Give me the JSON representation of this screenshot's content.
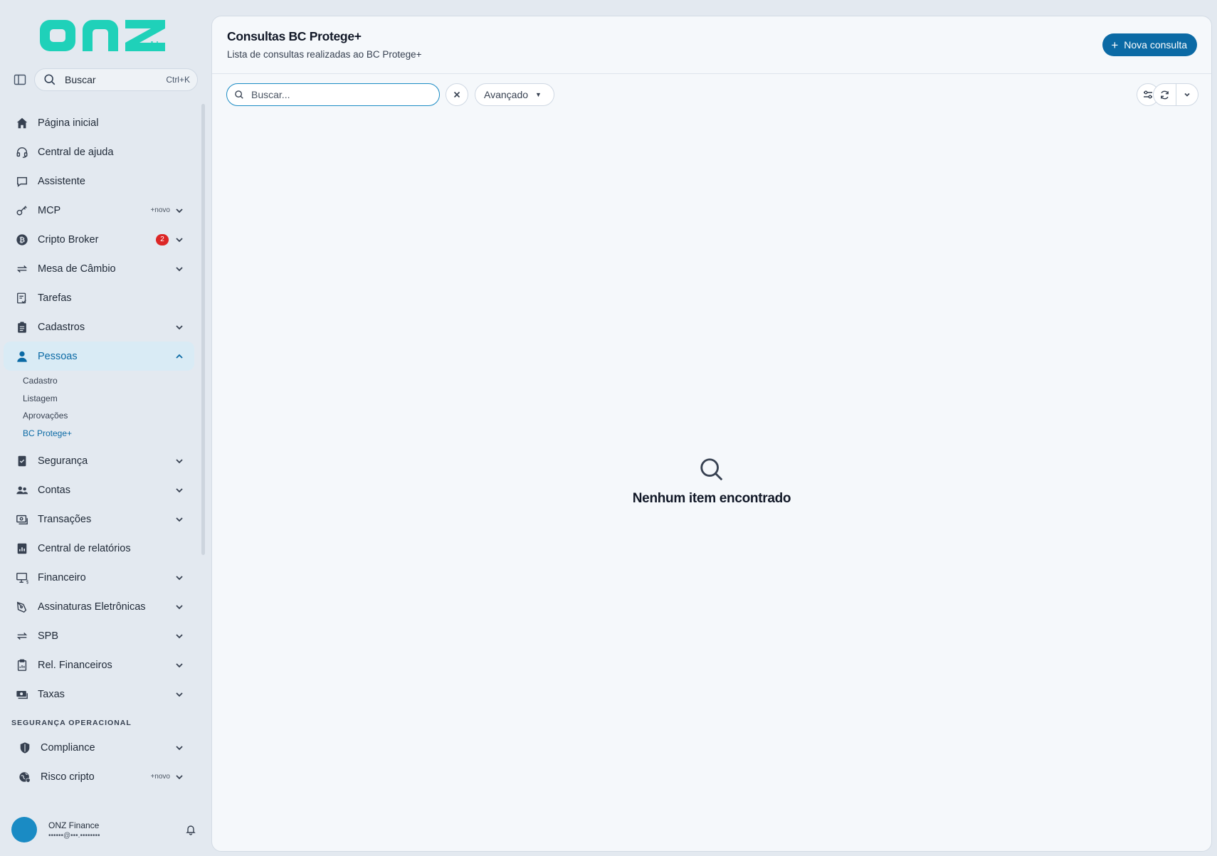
{
  "app": {
    "logo_text": "onz",
    "brand_color": "#1fd1b9",
    "accent_color": "#0b6aa5"
  },
  "sidebar": {
    "search_label": "Buscar",
    "search_shortcut": "Ctrl+K",
    "items": [
      {
        "label": "Página inicial",
        "icon": "home-icon"
      },
      {
        "label": "Central de ajuda",
        "icon": "headset-icon"
      },
      {
        "label": "Assistente",
        "icon": "chat-icon"
      },
      {
        "label": "MCP",
        "icon": "key-icon",
        "tag": "+novo"
      },
      {
        "label": "Cripto Broker",
        "icon": "bitcoin-icon",
        "badge": "2"
      },
      {
        "label": "Mesa de Câmbio",
        "icon": "exchange-icon"
      },
      {
        "label": "Tarefas",
        "icon": "tasks-icon"
      },
      {
        "label": "Cadastros",
        "icon": "clipboard-icon"
      },
      {
        "label": "Pessoas",
        "icon": "person-icon"
      },
      {
        "label": "Segurança",
        "icon": "shield-phone-icon"
      },
      {
        "label": "Contas",
        "icon": "users-icon"
      },
      {
        "label": "Transações",
        "icon": "transactions-icon"
      },
      {
        "label": "Central de relatórios",
        "icon": "report-icon"
      },
      {
        "label": "Financeiro",
        "icon": "monitor-money-icon"
      },
      {
        "label": "Assinaturas Eletrônicas",
        "icon": "pen-icon"
      },
      {
        "label": "SPB",
        "icon": "transfer-icon"
      },
      {
        "label": "Rel. Financeiros",
        "icon": "doc-money-icon"
      },
      {
        "label": "Taxas",
        "icon": "cash-icon"
      }
    ],
    "pessoas_subitems": [
      "Cadastro",
      "Listagem",
      "Aprovações",
      "BC Protege+"
    ],
    "section_title": "SEGURANÇA OPERACIONAL",
    "section_items": [
      {
        "label": "Compliance",
        "icon": "shield-check-icon"
      },
      {
        "label": "Risco cripto",
        "icon": "globe-shield-icon",
        "tag": "+novo"
      }
    ],
    "user": {
      "name": "ONZ Finance",
      "email": "••••••@•••.••••••••"
    }
  },
  "main": {
    "title": "Consultas BC Protege+",
    "subtitle": "Lista de consultas realizadas ao BC Protege+",
    "primary_button": "Nova consulta",
    "search_placeholder": "Buscar...",
    "advanced_label": "Avançado",
    "empty_message": "Nenhum item encontrado"
  }
}
